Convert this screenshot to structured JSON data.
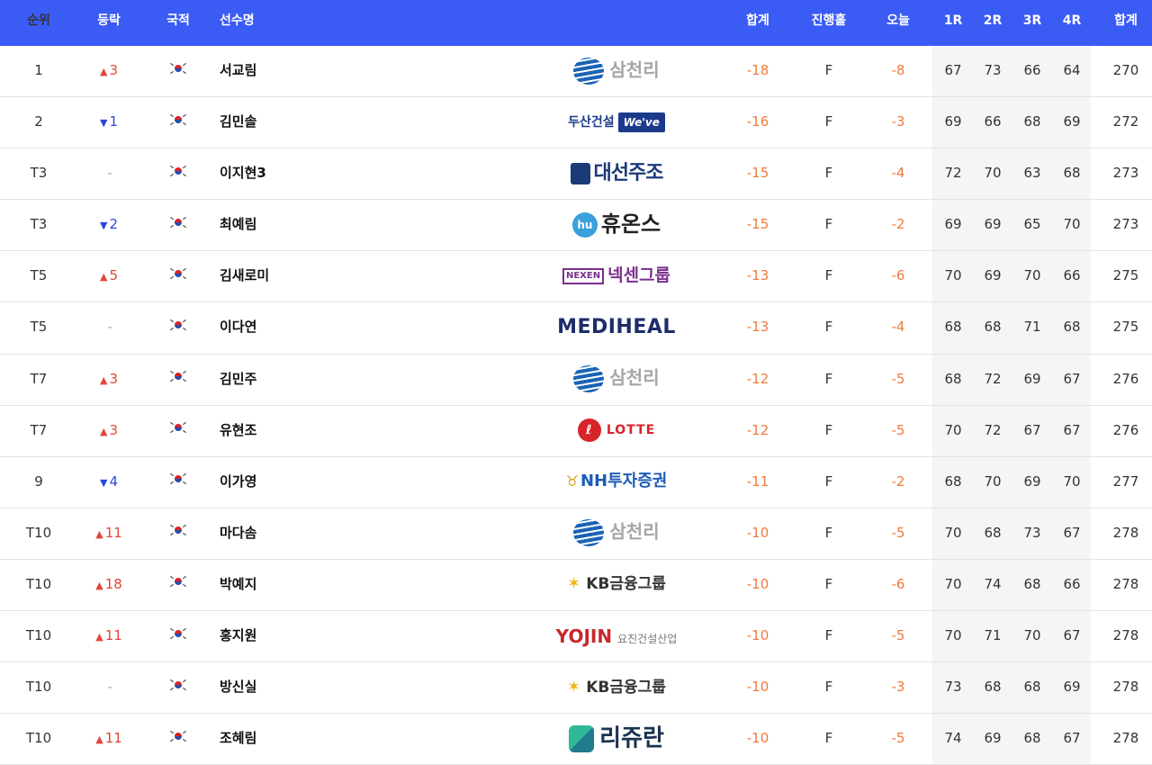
{
  "header": {
    "rank": "순위",
    "movement": "등락",
    "nationality": "국적",
    "player": "선수명",
    "total": "합계",
    "hole": "진행홀",
    "today": "오늘",
    "r1": "1R",
    "r2": "2R",
    "r3": "3R",
    "r4": "4R",
    "sum": "합계"
  },
  "colors": {
    "header_bg": "#3b5bf5",
    "score_orange": "#ef7a3c",
    "move_up": "#e2453c",
    "move_down": "#2a47d8"
  },
  "rows": [
    {
      "rank": "1",
      "move_dir": "up",
      "move": "3",
      "name": "서교림",
      "sponsor": "samchully",
      "sponsor_text": "삼천리",
      "total": "-18",
      "hole": "F",
      "today": "-8",
      "r1": "67",
      "r2": "73",
      "r3": "66",
      "r4": "64",
      "sum": "270"
    },
    {
      "rank": "2",
      "move_dir": "down",
      "move": "1",
      "name": "김민솔",
      "sponsor": "doosan",
      "sponsor_text": "두산건설",
      "sponsor_sub": "We've",
      "total": "-16",
      "hole": "F",
      "today": "-3",
      "r1": "69",
      "r2": "66",
      "r3": "68",
      "r4": "69",
      "sum": "272"
    },
    {
      "rank": "T3",
      "move_dir": "none",
      "move": "-",
      "name": "이지현3",
      "sponsor": "daesun",
      "sponsor_text": "대선주조",
      "total": "-15",
      "hole": "F",
      "today": "-4",
      "r1": "72",
      "r2": "70",
      "r3": "63",
      "r4": "68",
      "sum": "273"
    },
    {
      "rank": "T3",
      "move_dir": "down",
      "move": "2",
      "name": "최예림",
      "sponsor": "huons",
      "sponsor_text": "휴온스",
      "sponsor_sub": "hu",
      "total": "-15",
      "hole": "F",
      "today": "-2",
      "r1": "69",
      "r2": "69",
      "r3": "65",
      "r4": "70",
      "sum": "273"
    },
    {
      "rank": "T5",
      "move_dir": "up",
      "move": "5",
      "name": "김새로미",
      "sponsor": "nexen",
      "sponsor_text": "넥센그룹",
      "sponsor_sub": "NEXEN",
      "total": "-13",
      "hole": "F",
      "today": "-6",
      "r1": "70",
      "r2": "69",
      "r3": "70",
      "r4": "66",
      "sum": "275"
    },
    {
      "rank": "T5",
      "move_dir": "none",
      "move": "-",
      "name": "이다연",
      "sponsor": "mediheal",
      "sponsor_text": "MEDIHEAL",
      "total": "-13",
      "hole": "F",
      "today": "-4",
      "r1": "68",
      "r2": "68",
      "r3": "71",
      "r4": "68",
      "sum": "275"
    },
    {
      "rank": "T7",
      "move_dir": "up",
      "move": "3",
      "name": "김민주",
      "sponsor": "samchully",
      "sponsor_text": "삼천리",
      "total": "-12",
      "hole": "F",
      "today": "-5",
      "r1": "68",
      "r2": "72",
      "r3": "69",
      "r4": "67",
      "sum": "276"
    },
    {
      "rank": "T7",
      "move_dir": "up",
      "move": "3",
      "name": "유현조",
      "sponsor": "lotte",
      "sponsor_text": "LOTTE",
      "sponsor_sub": "ℓ",
      "total": "-12",
      "hole": "F",
      "today": "-5",
      "r1": "70",
      "r2": "72",
      "r3": "67",
      "r4": "67",
      "sum": "276"
    },
    {
      "rank": "9",
      "move_dir": "down",
      "move": "4",
      "name": "이가영",
      "sponsor": "nh",
      "sponsor_text": "NH투자증권",
      "total": "-11",
      "hole": "F",
      "today": "-2",
      "r1": "68",
      "r2": "70",
      "r3": "69",
      "r4": "70",
      "sum": "277"
    },
    {
      "rank": "T10",
      "move_dir": "up",
      "move": "11",
      "name": "마다솜",
      "sponsor": "samchully",
      "sponsor_text": "삼천리",
      "total": "-10",
      "hole": "F",
      "today": "-5",
      "r1": "70",
      "r2": "68",
      "r3": "73",
      "r4": "67",
      "sum": "278"
    },
    {
      "rank": "T10",
      "move_dir": "up",
      "move": "18",
      "name": "박예지",
      "sponsor": "kb",
      "sponsor_text": "KB금융그룹",
      "total": "-10",
      "hole": "F",
      "today": "-6",
      "r1": "70",
      "r2": "74",
      "r3": "68",
      "r4": "66",
      "sum": "278"
    },
    {
      "rank": "T10",
      "move_dir": "up",
      "move": "11",
      "name": "홍지원",
      "sponsor": "yojin",
      "sponsor_text": "YOJIN",
      "sponsor_sub": "요진건설산업",
      "total": "-10",
      "hole": "F",
      "today": "-5",
      "r1": "70",
      "r2": "71",
      "r3": "70",
      "r4": "67",
      "sum": "278"
    },
    {
      "rank": "T10",
      "move_dir": "none",
      "move": "-",
      "name": "방신실",
      "sponsor": "kb",
      "sponsor_text": "KB금융그룹",
      "total": "-10",
      "hole": "F",
      "today": "-3",
      "r1": "73",
      "r2": "68",
      "r3": "68",
      "r4": "69",
      "sum": "278"
    },
    {
      "rank": "T10",
      "move_dir": "up",
      "move": "11",
      "name": "조혜림",
      "sponsor": "lyuran",
      "sponsor_text": "리쥬란",
      "total": "-10",
      "hole": "F",
      "today": "-5",
      "r1": "74",
      "r2": "69",
      "r3": "68",
      "r4": "67",
      "sum": "278"
    }
  ]
}
